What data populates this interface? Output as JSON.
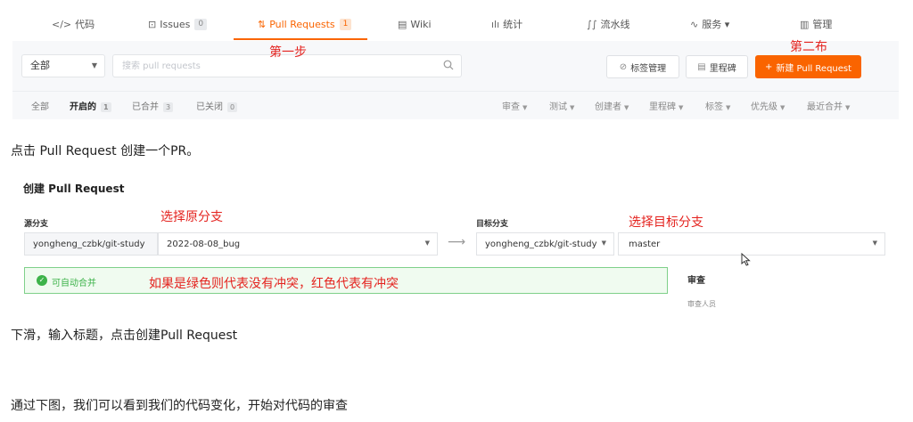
{
  "tabs": [
    {
      "icon": "</>",
      "label": "代码",
      "badge": ""
    },
    {
      "icon": "⊡",
      "label": "Issues",
      "badge": "0"
    },
    {
      "icon": "⇅",
      "label": "Pull Requests",
      "badge": "1"
    },
    {
      "icon": "▤",
      "label": "Wiki",
      "badge": ""
    },
    {
      "icon": "ılı",
      "label": "统计",
      "badge": ""
    },
    {
      "icon": "∫∫",
      "label": "流水线",
      "badge": ""
    },
    {
      "icon": "∿",
      "label": "服务 ▾",
      "badge": ""
    },
    {
      "icon": "▥",
      "label": "管理",
      "badge": ""
    }
  ],
  "filter": {
    "scope": "全部",
    "search_placeholder": "搜索 pull requests",
    "label_manage": "标签管理",
    "milestone": "里程碑",
    "new_pr": "新建 Pull Request"
  },
  "states": [
    {
      "label": "全部",
      "count": ""
    },
    {
      "label": "开启的",
      "count": "1"
    },
    {
      "label": "已合并",
      "count": "3"
    },
    {
      "label": "已关闭",
      "count": "0"
    }
  ],
  "filters": [
    "审查",
    "测试",
    "创建者",
    "里程碑",
    "标签",
    "优先级",
    "最近合并"
  ],
  "notes": {
    "step1": "第一步",
    "step2": "第二布",
    "source_branch": "选择原分支",
    "target_branch": "选择目标分支",
    "conflict": "如果是绿色则代表没有冲突，红色代表有冲突"
  },
  "paragraphs": {
    "p1": "点击 Pull Request 创建一个PR。",
    "p2": "下滑，输入标题，点击创建Pull Request",
    "p3": "通过下图，我们可以看到我们的代码变化，开始对代码的审查"
  },
  "create": {
    "title": "创建 Pull Request",
    "source_label": "源分支",
    "source_repo": "yongheng_czbk/git-study",
    "source_branch": "2022-08-08_bug",
    "target_label": "目标分支",
    "target_repo": "yongheng_czbk/git-study",
    "target_branch": "master",
    "merge_status": "可自动合并",
    "review_title": "审查",
    "review_sub": "审查人员"
  },
  "colors": {
    "accent": "#fa6400",
    "annotation": "#e4231f",
    "ok_green": "#3db34a"
  }
}
